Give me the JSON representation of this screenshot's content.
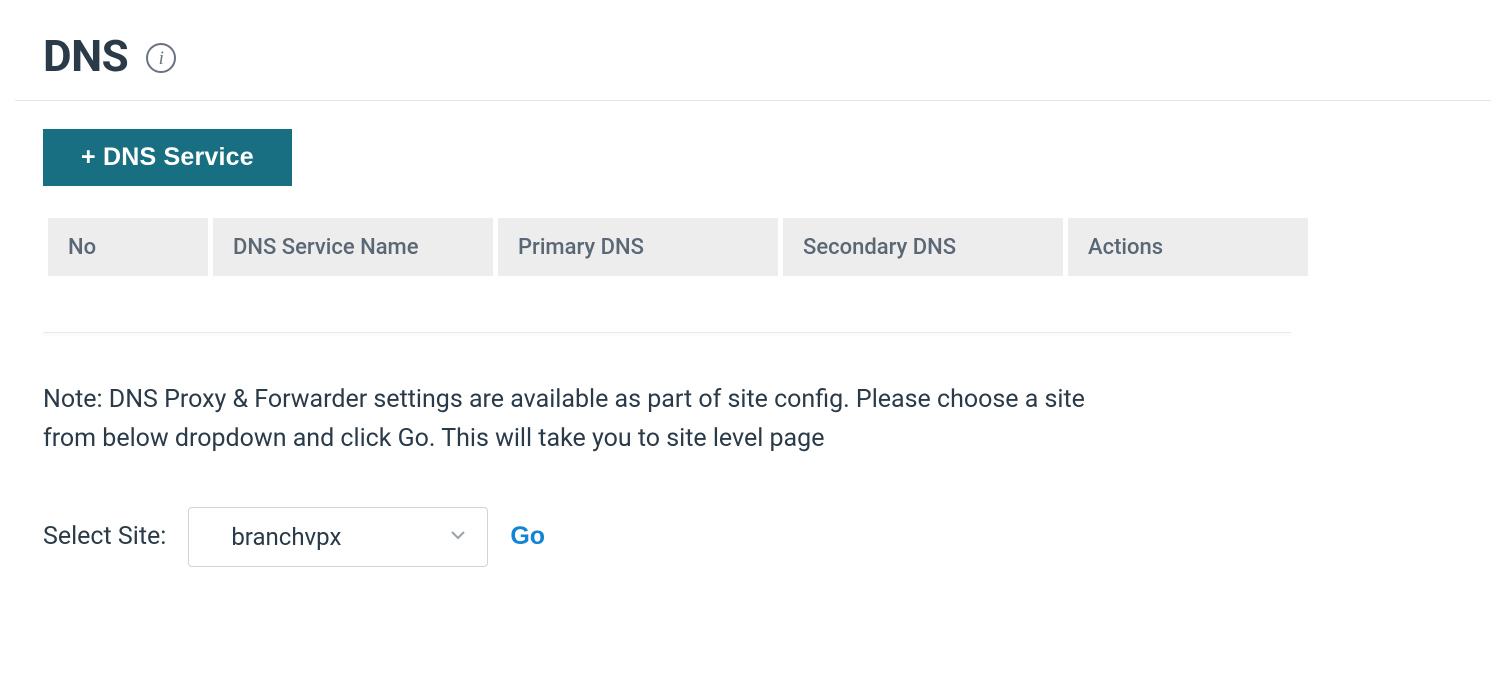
{
  "header": {
    "title": "DNS"
  },
  "buttons": {
    "add_dns_service": "+ DNS Service",
    "go": "Go"
  },
  "table": {
    "headers": {
      "no": "No",
      "name": "DNS Service Name",
      "primary": "Primary DNS",
      "secondary": "Secondary DNS",
      "actions": "Actions"
    },
    "rows": []
  },
  "note": "Note: DNS Proxy & Forwarder settings are available as part of site config. Please choose a site from below dropdown and click Go. This will take you to site level page",
  "site_selector": {
    "label": "Select Site:",
    "selected": "branchvpx"
  }
}
